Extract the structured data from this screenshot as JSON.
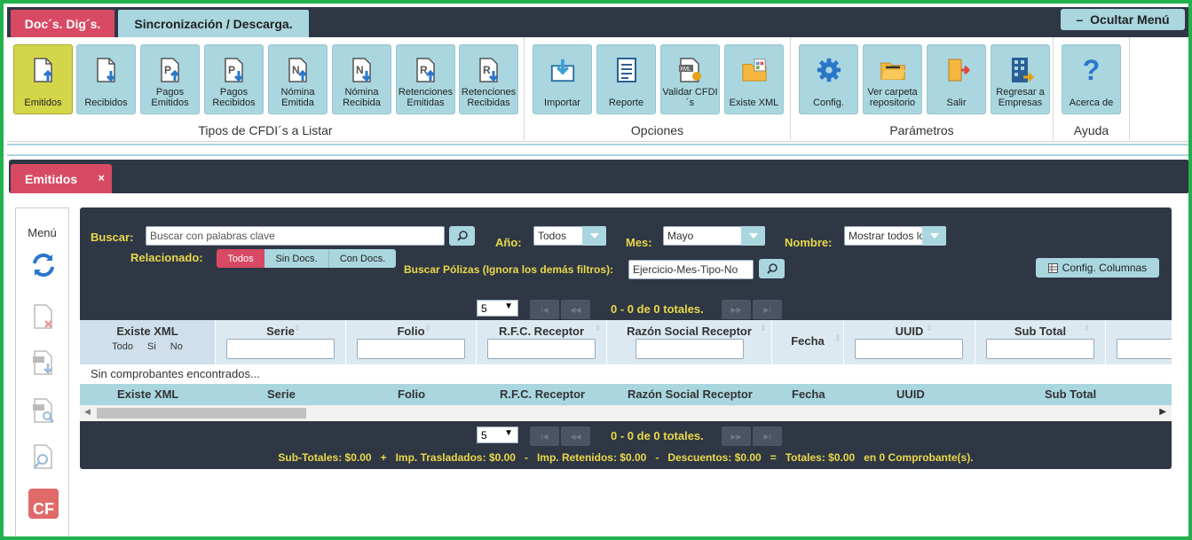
{
  "top_tabs": {
    "docs": "Doc´s. Dig´s.",
    "sync": "Sincronización / Descarga.",
    "hide_menu": "Ocultar Menú",
    "hide_menu_symbol": "–"
  },
  "ribbon": {
    "groups": {
      "tipos": "Tipos de CFDI´s a Listar",
      "opciones": "Opciones",
      "parametros": "Parámetros",
      "ayuda": "Ayuda"
    },
    "buttons": {
      "emitidos": "Emitidos",
      "recibidos": "Recibidos",
      "pagos_emitidos": "Pagos Emitidos",
      "pagos_recibidos": "Pagos Recibidos",
      "nomina_emitida": "Nómina Emitida",
      "nomina_recibida": "Nómina Recibida",
      "retenciones_emitidas": "Retenciones Emitidas",
      "retenciones_recibidas": "Retenciones Recibidas",
      "importar": "Importar",
      "reporte": "Reporte",
      "validar": "Validar CFDI´s",
      "existe_xml": "Existe XML",
      "config": "Config.",
      "ver_carpeta": "Ver carpeta repositorio",
      "salir": "Salir",
      "regresar": "Regresar a Empresas",
      "acerca": "Acerca de"
    },
    "icon_letters": {
      "p": "P",
      "n": "N",
      "r": "R",
      "xml": "XML",
      "question": "?"
    }
  },
  "doc_tab": {
    "label": "Emitidos",
    "close": "×"
  },
  "side_menu": {
    "title": "Menú",
    "cf_badge": "CF"
  },
  "filters": {
    "buscar_label": "Buscar:",
    "buscar_placeholder": "Buscar con palabras clave",
    "anio_label": "Año:",
    "anio_value": "Todos",
    "mes_label": "Mes:",
    "mes_value": "Mayo",
    "nombre_label": "Nombre:",
    "nombre_value": "Mostrar todos lo",
    "relacionado_label": "Relacionado:",
    "rel_options": [
      "Todos",
      "Sin Docs.",
      "Con Docs."
    ],
    "polizas_label": "Buscar Pólizas (Ignora los demás filtros):",
    "polizas_value": "Ejercicio-Mes-Tipo-No",
    "config_columnas": "Config. Columnas"
  },
  "pager": {
    "page_size": "5",
    "info": "0 - 0 de 0 totales.",
    "caret": "▼",
    "first": "|◀",
    "prev": "◀◀",
    "next": "▶▶",
    "last": "▶|"
  },
  "table": {
    "columns": [
      "Existe XML",
      "Serie",
      "Folio",
      "R.F.C. Receptor",
      "Razón Social Receptor",
      "Fecha",
      "UUID",
      "Sub Total"
    ],
    "xml_options": [
      "Todo",
      "Si",
      "No"
    ],
    "empty_text": "Sin comprobantes encontrados...",
    "sort_symbol": "⇕"
  },
  "totals": "Sub-Totales: $0.00   +   Imp. Trasladados: $0.00   -   Imp. Retenidos: $0.00   -   Descuentos: $0.00   =   Totales: $0.00   en 0 Comprobante(s).",
  "colors": {
    "accent_red": "#d84a64",
    "accent_teal": "#a9d6df",
    "dark": "#2f3744",
    "yellow": "#e8d84a",
    "active": "#d4d64a",
    "border_green": "#22b14c"
  }
}
